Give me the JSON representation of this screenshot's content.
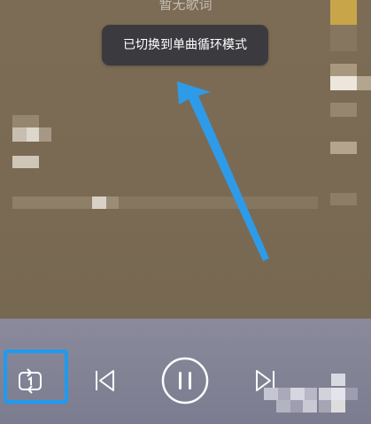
{
  "lyrics": {
    "no_lyrics_text": "暂无歌词"
  },
  "toast": {
    "message": "已切换到单曲循环模式"
  },
  "colors": {
    "accent": "#1e9bf0",
    "toast_bg": "#3b3b3f",
    "lyrics_bg": "#7a6a54",
    "controls_bg": "#84849a"
  },
  "controls": {
    "play_mode": {
      "icon": "repeat-one-icon",
      "mode": "single-loop"
    },
    "previous": {
      "icon": "previous-track-icon"
    },
    "play_pause": {
      "icon": "pause-icon",
      "state": "playing"
    },
    "next": {
      "icon": "next-track-icon"
    },
    "playlist": {
      "icon": "playlist-icon"
    }
  }
}
